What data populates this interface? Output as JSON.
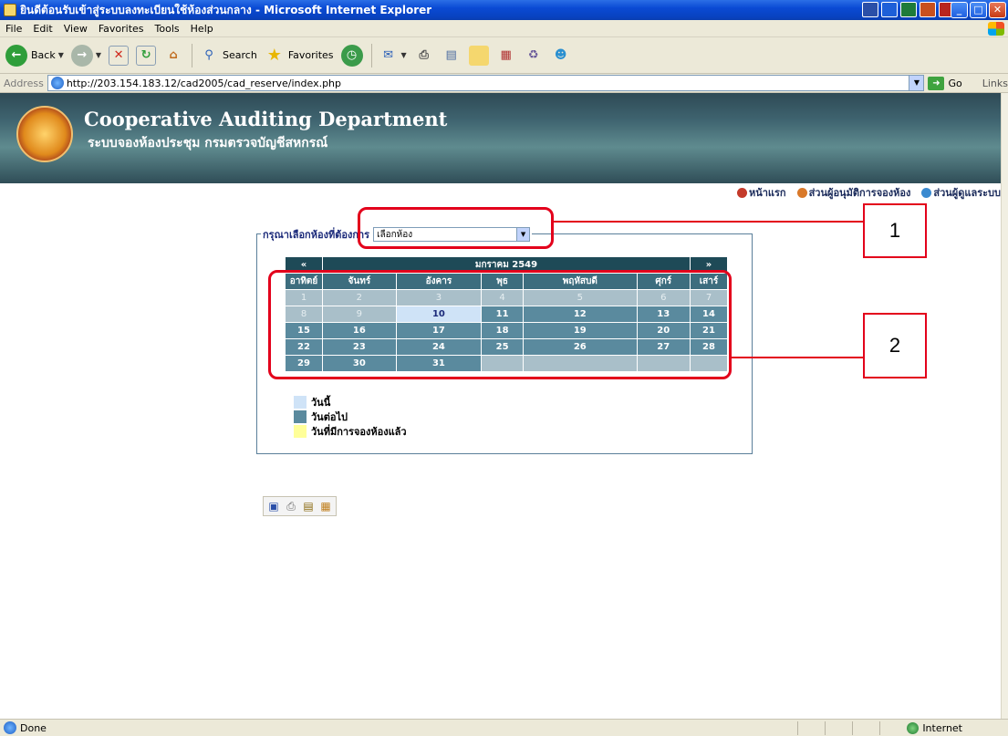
{
  "window": {
    "title": "ยินดีต้อนรับเข้าสู่ระบบลงทะเบียนใช้ห้องส่วนกลาง - Microsoft Internet Explorer",
    "min": "_",
    "max": "□",
    "close": "✕"
  },
  "menu": {
    "items": [
      "File",
      "Edit",
      "View",
      "Favorites",
      "Tools",
      "Help"
    ]
  },
  "toolbar": {
    "back_label": "Back",
    "search_label": "Search",
    "favorites_label": "Favorites"
  },
  "address": {
    "label": "Address",
    "url": "http://203.154.183.12/cad2005/cad_reserve/index.php",
    "go_label": "Go",
    "links_label": "Links"
  },
  "banner": {
    "title": "Cooperative Auditing Department",
    "subtitle": "ระบบจองห้องประชุม กรมตรวจบัญชีสหกรณ์"
  },
  "top_links": [
    "หน้าแรก",
    "ส่วนผู้อนุมัติการจองห้อง",
    "ส่วนผู้ดูแลระบบ"
  ],
  "panel": {
    "legend_text": "กรุณาเลือกห้องที่ต้องการ",
    "select_value": "เลือกห้อง"
  },
  "calendar": {
    "prev": "«",
    "next": "»",
    "month": "มกราคม 2549",
    "weekdays": [
      "อาทิตย์",
      "จันทร์",
      "อังคาร",
      "พุธ",
      "พฤหัสบดี",
      "ศุกร์",
      "เสาร์"
    ],
    "weeks": [
      [
        "1",
        "2",
        "3",
        "4",
        "5",
        "6",
        "7"
      ],
      [
        "8",
        "9",
        "10",
        "11",
        "12",
        "13",
        "14"
      ],
      [
        "15",
        "16",
        "17",
        "18",
        "19",
        "20",
        "21"
      ],
      [
        "22",
        "23",
        "24",
        "25",
        "26",
        "27",
        "28"
      ],
      [
        "29",
        "30",
        "31",
        "",
        "",
        "",
        ""
      ]
    ],
    "today": "10"
  },
  "legend": {
    "today": "วันนี้",
    "upcoming": "วันต่อไป",
    "booked": "วันที่มีการจองห้องแล้ว"
  },
  "annotations": {
    "label1": "1",
    "label2": "2"
  },
  "status": {
    "text": "Done",
    "zone": "Internet"
  },
  "colors": {
    "today": "#cfe3f7",
    "upcoming": "#5a8a9e",
    "booked": "#ffff99",
    "annotation": "#e3001b"
  }
}
